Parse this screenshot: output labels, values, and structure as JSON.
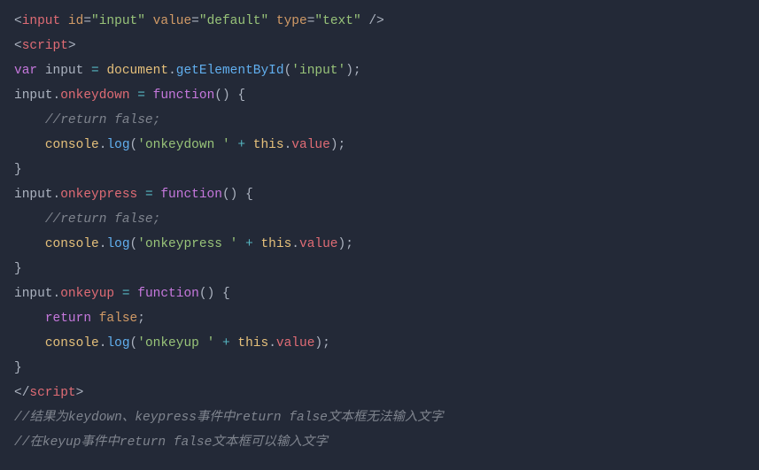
{
  "code": {
    "input_tag": {
      "name": "input",
      "id_attr": "id",
      "id_val": "input",
      "value_attr": "value",
      "value_val": "default",
      "type_attr": "type",
      "type_val": "text"
    },
    "script_open": "script",
    "var_kw": "var",
    "var_name": "input",
    "doc": "document",
    "getById": "getElementById",
    "getById_arg": "input",
    "handlers": {
      "onkeydown": {
        "obj": "input",
        "prop": "onkeydown",
        "fn_kw": "function",
        "comment": "//return false;",
        "console": "console",
        "log": "log",
        "msg": "onkeydown ",
        "this": "this",
        "value": "value"
      },
      "onkeypress": {
        "obj": "input",
        "prop": "onkeypress",
        "fn_kw": "function",
        "comment": "//return false;",
        "console": "console",
        "log": "log",
        "msg": "onkeypress ",
        "this": "this",
        "value": "value"
      },
      "onkeyup": {
        "obj": "input",
        "prop": "onkeyup",
        "fn_kw": "function",
        "return_kw": "return",
        "false_val": "false",
        "console": "console",
        "log": "log",
        "msg": "onkeyup ",
        "this": "this",
        "value": "value"
      }
    },
    "script_close": "script",
    "foot_comment1": "//结果为keydown、keypress事件中return false文本框无法输入文字",
    "foot_comment2": "//在keyup事件中return false文本框可以输入文字"
  }
}
